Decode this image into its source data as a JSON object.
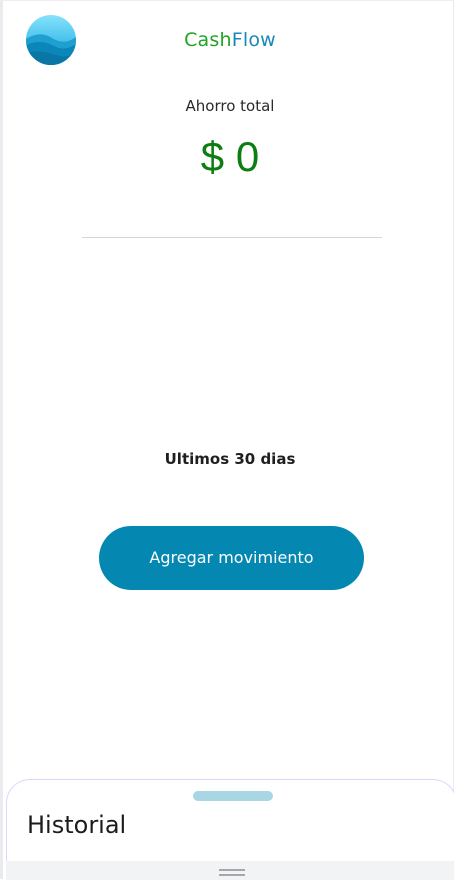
{
  "header": {
    "logo_icon": "water-wave-logo-icon",
    "brand_part1": "Cash",
    "brand_part2": "Flow",
    "brand_colors": {
      "cash": "#20a424",
      "flow": "#1789b8"
    }
  },
  "summary": {
    "label": "Ahorro total",
    "value": "$ 0",
    "value_color": "#0b7d11"
  },
  "period_label": "Ultimos 30 dias",
  "actions": {
    "add_movement_label": "Agregar movimiento",
    "accent_color": "#0488b2"
  },
  "history_sheet": {
    "title": "Historial",
    "handle_color": "#a8d6e2"
  },
  "system_bar": {
    "grip_icon": "drag-grip-icon"
  }
}
